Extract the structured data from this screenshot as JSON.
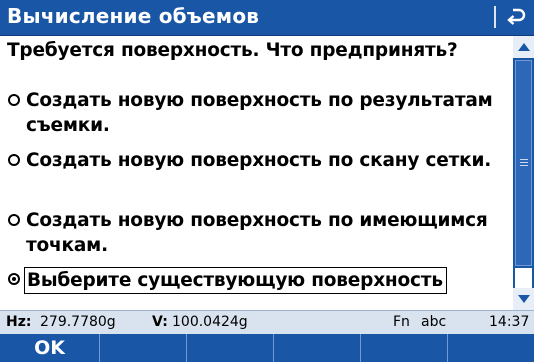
{
  "title": "Вычисление объемов",
  "prompt": "Требуется поверхность. Что предпринять?",
  "options": [
    {
      "label": "Создать новую поверхность по результатам съемки.",
      "selected": false
    },
    {
      "label": "Создать новую поверхность по скану сетки.",
      "selected": false
    },
    {
      "label": "Создать новую поверхность по имеющимся точкам.",
      "selected": false
    },
    {
      "label": "Выберите существующую поверхность",
      "selected": true
    }
  ],
  "status": {
    "hz_label": "Hz:",
    "hz_value": "279.7780g",
    "v_label": "V:",
    "v_value": "100.0424g",
    "fn": "Fn",
    "input_mode": "abc",
    "time": "14:37"
  },
  "softkeys": [
    "OK",
    "",
    "",
    "",
    "",
    ""
  ],
  "icons": {
    "back": "back-arrow-icon",
    "scroll_up": "arrow-up-icon",
    "scroll_down": "arrow-down-icon"
  },
  "colors": {
    "titlebar": "#1a56a6",
    "statusbar": "#d9e2ef",
    "softkeys": "#1a56a6"
  }
}
